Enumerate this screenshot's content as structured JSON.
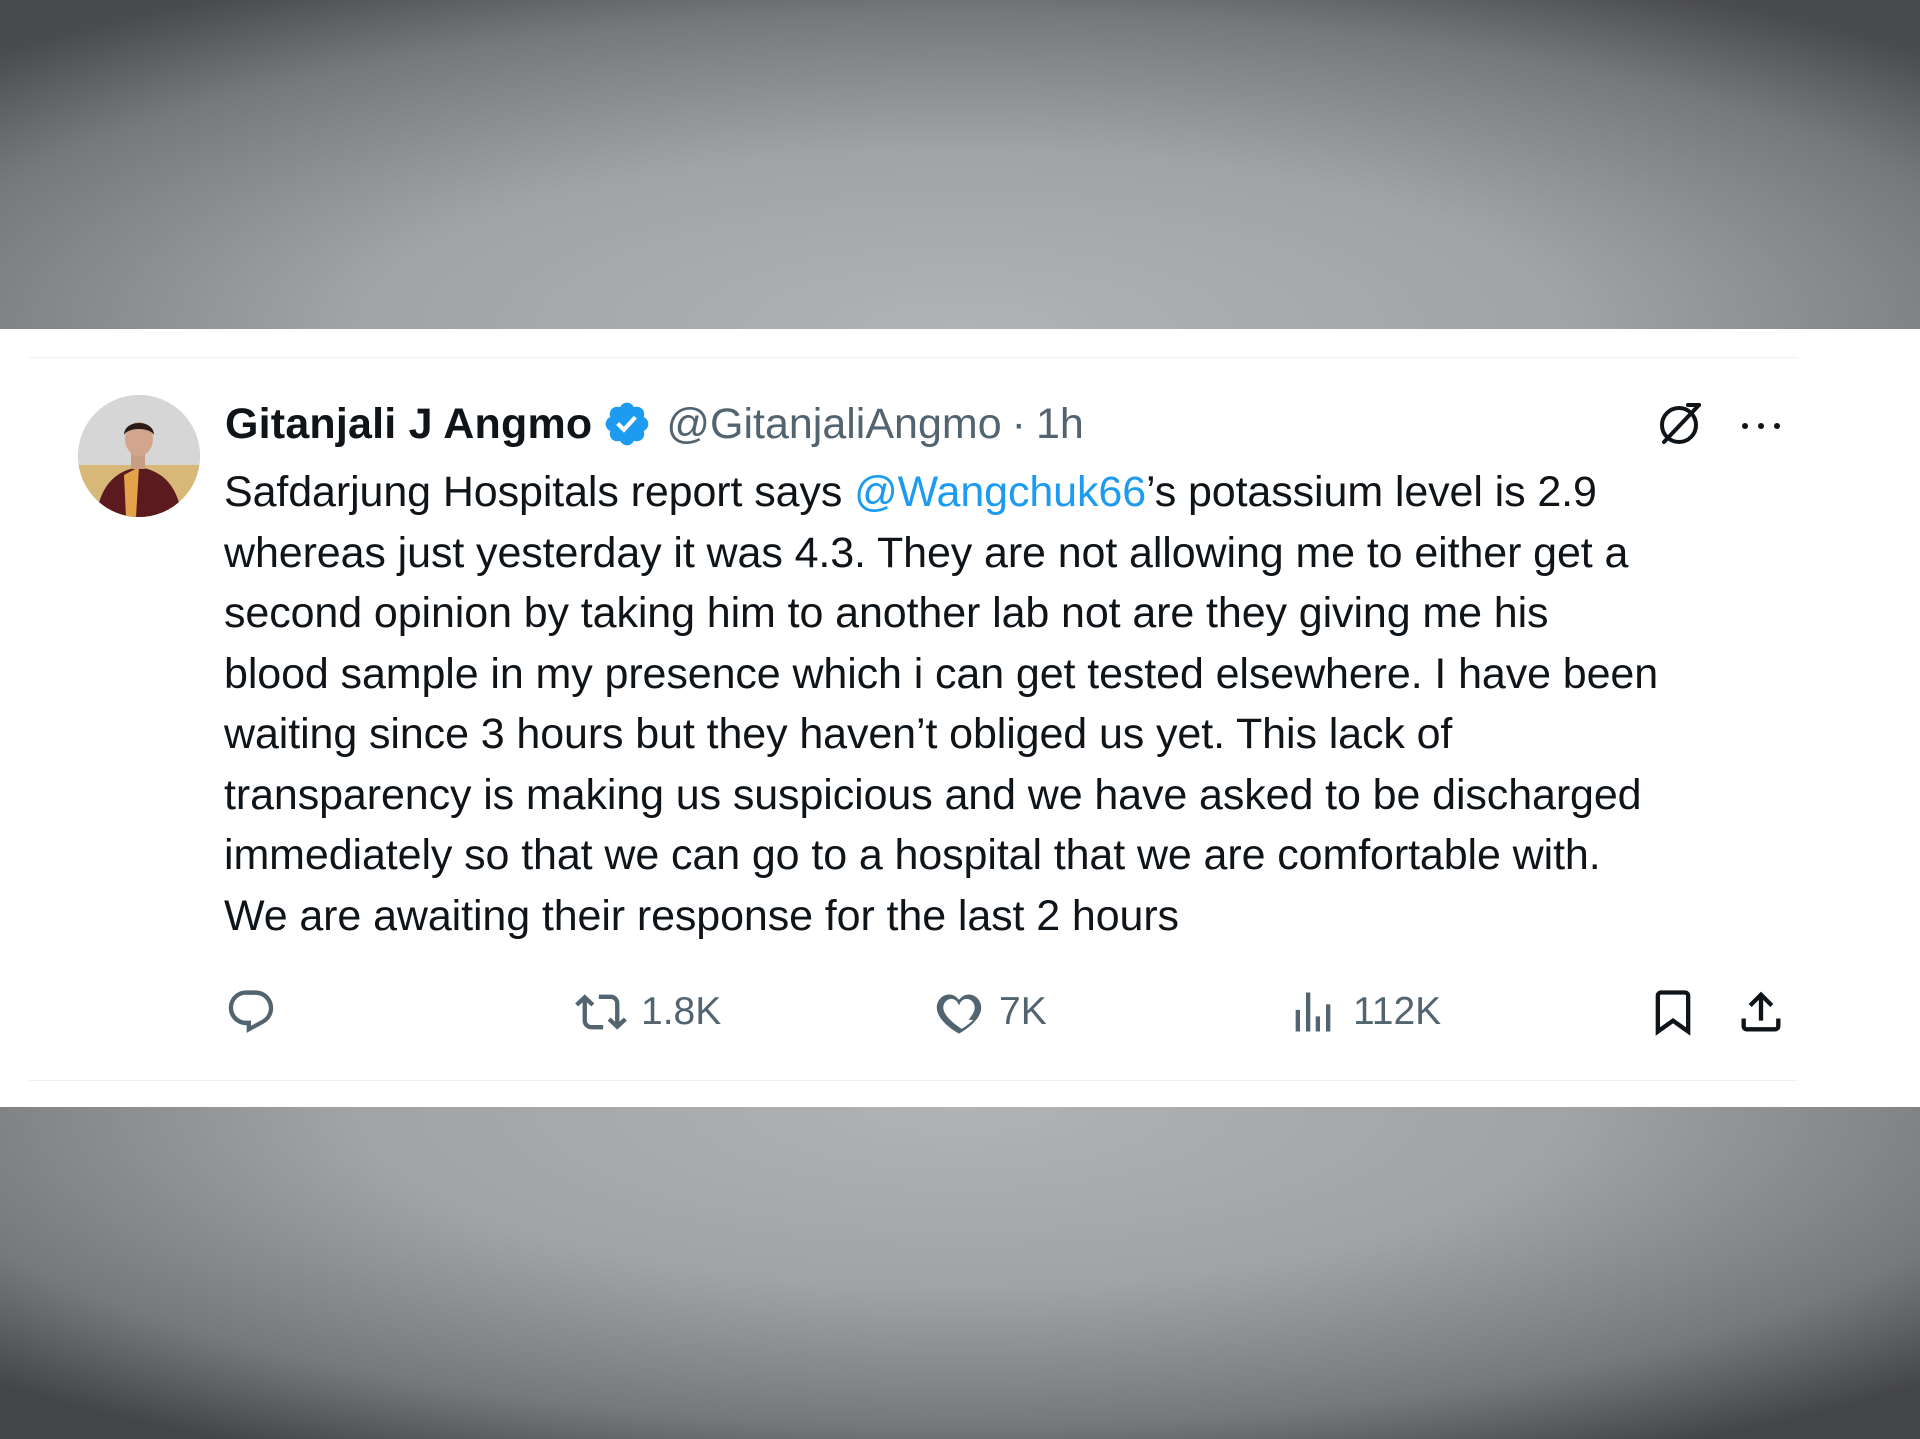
{
  "tweet": {
    "display_name": "Gitanjali J Angmo",
    "handle": "@GitanjaliAngmo",
    "separator": "·",
    "time": "1h",
    "text_before_mention": "Safdarjung Hospitals report says ",
    "mention": "@Wangchuk66",
    "text_after_mention": "’s potassium level is 2.9\nwhereas just yesterday it was 4.3. They are not allowing me to either get a\nsecond opinion by taking him to another lab not are they giving me his\nblood sample in my presence which i can get tested elsewhere. I have been\nwaiting since 3 hours but they haven’t obliged us yet. This lack of\ntransparency is making us suspicious and we have asked to be discharged\nimmediately so that we can go to a hospital that we are comfortable with.\nWe are awaiting their response for the last 2 hours"
  },
  "actions": {
    "reply_count": "",
    "retweet_count": "1.8K",
    "like_count": "7K",
    "view_count": "112K"
  },
  "icons": {
    "verified": "verified-badge-icon",
    "grok": "grok-icon",
    "more": "more-icon",
    "reply": "reply-icon",
    "retweet": "retweet-icon",
    "like": "heart-icon",
    "views": "views-icon",
    "bookmark": "bookmark-icon",
    "share": "share-icon"
  },
  "colors": {
    "text": "#0f1419",
    "muted": "#536471",
    "accent": "#1d9bf0",
    "card": "#ffffff"
  }
}
